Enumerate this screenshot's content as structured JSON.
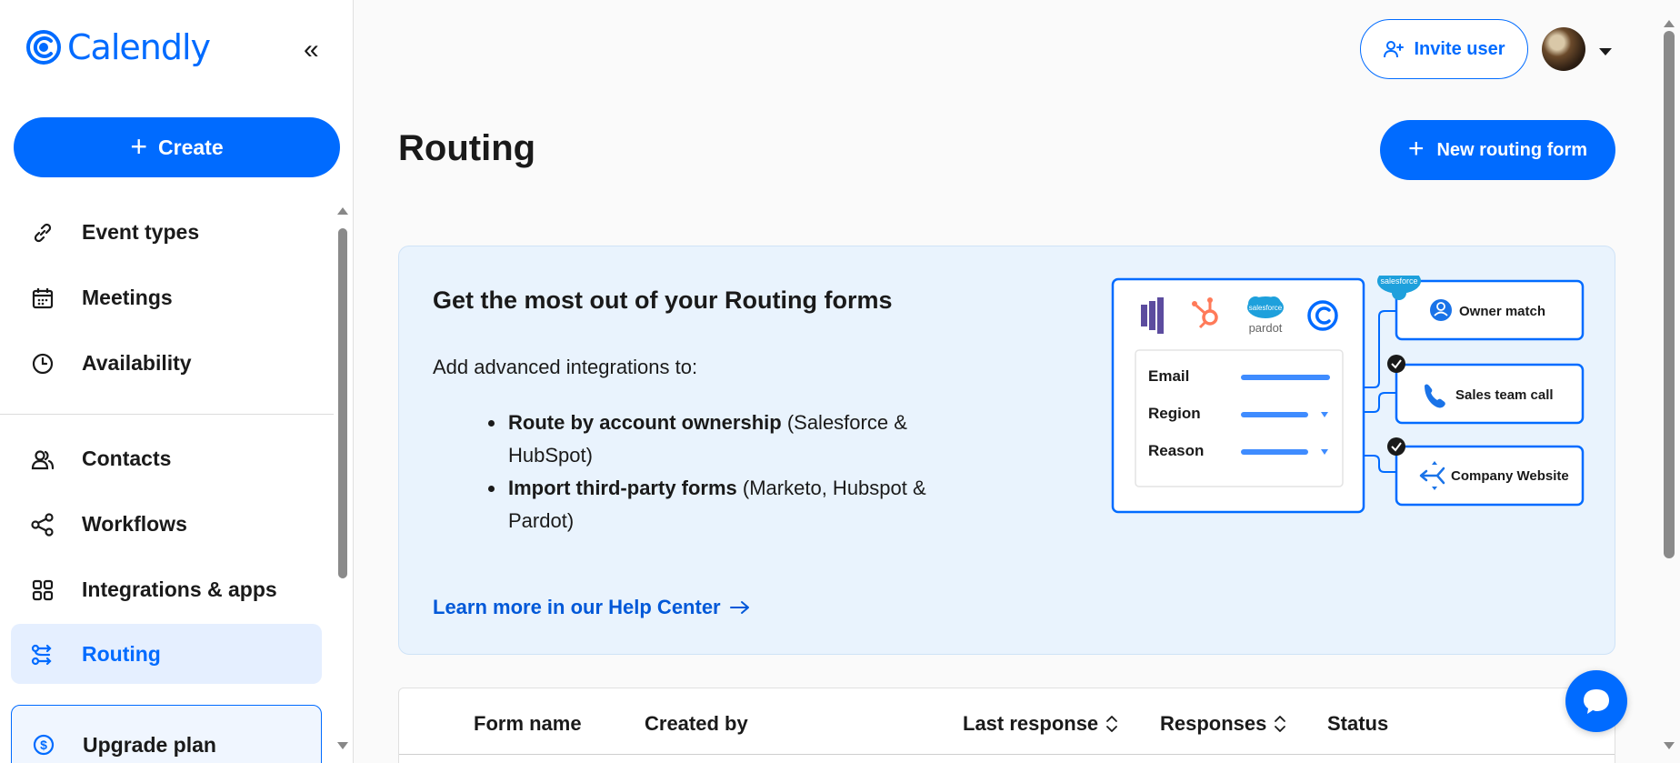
{
  "app": {
    "name": "Calendly"
  },
  "sidebar": {
    "create_label": "Create",
    "items": [
      {
        "label": "Event types",
        "icon": "link-icon"
      },
      {
        "label": "Meetings",
        "icon": "calendar-icon"
      },
      {
        "label": "Availability",
        "icon": "clock-icon"
      },
      {
        "label": "Contacts",
        "icon": "contacts-icon"
      },
      {
        "label": "Workflows",
        "icon": "workflow-icon"
      },
      {
        "label": "Integrations & apps",
        "icon": "grid-icon"
      },
      {
        "label": "Routing",
        "icon": "routing-icon",
        "active": true
      }
    ],
    "upgrade_label": "Upgrade plan"
  },
  "header": {
    "invite_label": "Invite user"
  },
  "page": {
    "title": "Routing",
    "new_form_label": "New routing form"
  },
  "promo": {
    "title": "Get the most out of your Routing forms",
    "intro": "Add advanced integrations to:",
    "bullets": [
      {
        "bold": "Route by account ownership",
        "rest": " (Salesforce & HubSpot)"
      },
      {
        "bold": "Import third-party forms",
        "rest": " (Marketo, Hubspot & Pardot)"
      }
    ],
    "learn_more": "Learn more in our Help Center",
    "illustration": {
      "logos": [
        "marketo-logo",
        "hubspot-logo",
        "salesforce-pardot-logo",
        "calendly-logo"
      ],
      "salesforce_text": "salesforce",
      "pardot_text": "pardot",
      "fields": [
        "Email",
        "Region",
        "Reason"
      ],
      "outcomes": [
        "Owner match",
        "Sales team call",
        "Company Website"
      ]
    }
  },
  "table": {
    "columns": [
      "Form name",
      "Created by",
      "Last response",
      "Responses",
      "Status"
    ]
  },
  "colors": {
    "brand": "#006bff",
    "promo_bg": "#e9f3fd",
    "active_nav_bg": "#e5efff"
  }
}
